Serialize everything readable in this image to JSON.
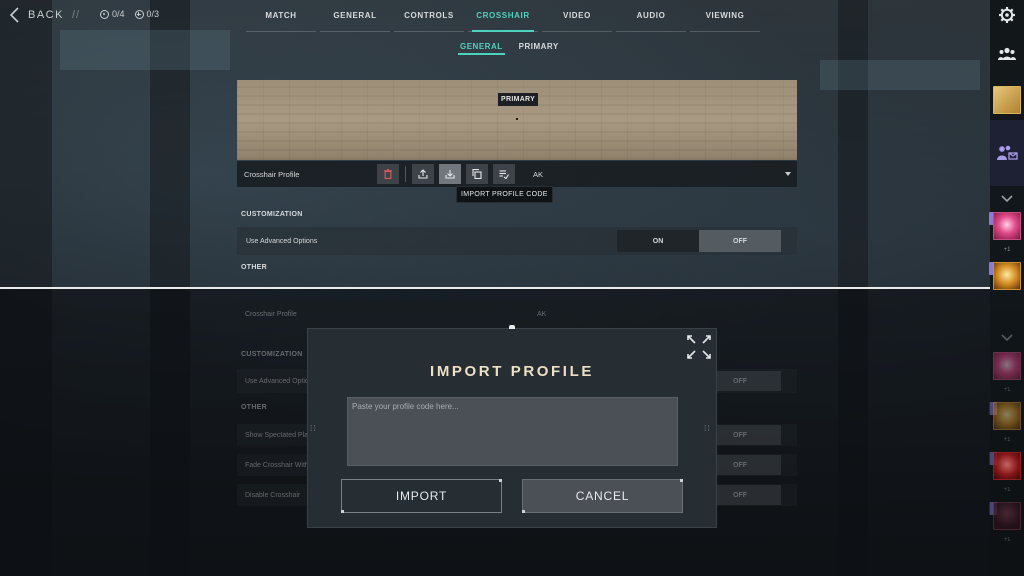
{
  "header": {
    "back_label": "BACK",
    "back_sep": "//",
    "counter_1": "0/4",
    "counter_2": "0/3"
  },
  "nav": {
    "tabs": [
      {
        "label": "MATCH"
      },
      {
        "label": "GENERAL"
      },
      {
        "label": "CONTROLS"
      },
      {
        "label": "CROSSHAIR"
      },
      {
        "label": "VIDEO"
      },
      {
        "label": "AUDIO"
      },
      {
        "label": "VIEWING"
      }
    ],
    "active_tab": "CROSSHAIR",
    "subtabs": [
      {
        "label": "GENERAL"
      },
      {
        "label": "PRIMARY"
      }
    ],
    "active_subtab": "GENERAL"
  },
  "preview": {
    "tag": "PRIMARY"
  },
  "profile": {
    "label": "Crosshair Profile",
    "selected": "AK",
    "tooltip": "IMPORT PROFILE CODE",
    "icons": [
      "trash-icon",
      "export-icon",
      "import-icon",
      "copy-icon",
      "rename-icon"
    ]
  },
  "customization": {
    "heading": "CUSTOMIZATION",
    "advanced_label": "Use Advanced Options",
    "on_label": "ON",
    "off_label": "OFF",
    "selected": "OFF"
  },
  "other": {
    "heading": "OTHER"
  },
  "ghost": {
    "profile_label": "Crosshair Profile",
    "profile_value": "AK",
    "customization": "CUSTOMIZATION",
    "advanced": "Use Advanced Optio",
    "other": "OTHER",
    "spectated": "Show Spectated Pla",
    "fade": "Fade Crosshair With",
    "disable": "Disable Crosshair",
    "off": "OFF"
  },
  "modal": {
    "title": "IMPORT PROFILE",
    "placeholder": "Paste your profile code here...",
    "import_label": "IMPORT",
    "cancel_label": "CANCEL"
  },
  "sidebar": {
    "counts": [
      "+1",
      "+1",
      "+1",
      "+1",
      "+1"
    ]
  },
  "colors": {
    "accent": "#4fd1c0",
    "modal_title": "#ede0c4",
    "friend_tag": "#8c7bd0"
  }
}
